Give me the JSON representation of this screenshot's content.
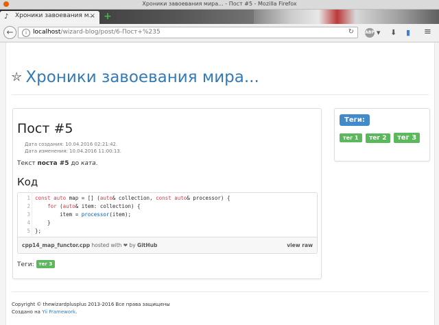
{
  "window": {
    "title": "Хроники завоевания мира... - Пост #5 - Mozilla Firefox"
  },
  "tab": {
    "label": "Хроники завоевания м...",
    "close": "×",
    "new_tab": "+"
  },
  "urlbar": {
    "host": "localhost",
    "path": "/wizard-blog/post/6-Пост+%235"
  },
  "toolbar": {
    "abp_label": "ABP"
  },
  "site": {
    "brand": "Хроники завоевания мира..."
  },
  "post": {
    "title": "Пост #5",
    "created": "Дата создания: 10.04.2016 02:21:42.",
    "modified": "Дата изменения: 10.04.2016 11:00:13.",
    "text_prefix": "Текст ",
    "text_bold": "поста #5",
    "text_middle": " до ",
    "text_italic": "ката",
    "text_suffix": ".",
    "code_heading": "Код",
    "tags_label": "Теги:",
    "tags": [
      "тег 3"
    ]
  },
  "gist": {
    "line_numbers": [
      "1",
      "2",
      "3",
      "4",
      "5"
    ],
    "filename": "cpp14_map_functor.cpp",
    "hosted_with": " hosted with ❤ by ",
    "host": "GitHub",
    "view_raw": "view raw"
  },
  "sidebar": {
    "heading": "Теги:",
    "tags": [
      "тег 1",
      "тег 2",
      "тег 3"
    ]
  },
  "footer": {
    "copyright": "Copyright © thewizardplusplus 2013-2016 Все права защищены",
    "created_with_prefix": "Создано на ",
    "framework": "Yii Framework",
    "created_with_suffix": "."
  },
  "colors": {
    "link": "#337ab7",
    "tag": "#5cb85c",
    "tags_heading": "#428bca"
  }
}
